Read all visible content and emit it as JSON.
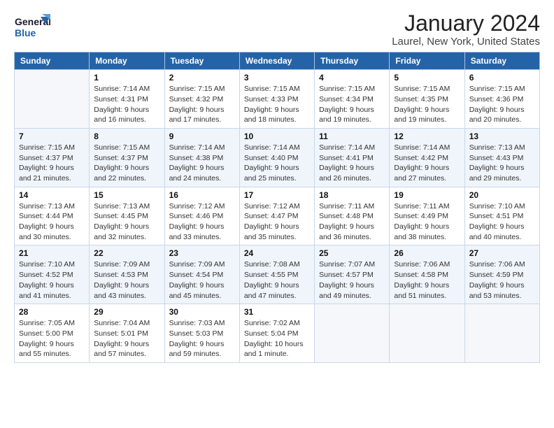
{
  "header": {
    "logo_general": "General",
    "logo_blue": "Blue",
    "title": "January 2024",
    "subtitle": "Laurel, New York, United States"
  },
  "calendar": {
    "days_of_week": [
      "Sunday",
      "Monday",
      "Tuesday",
      "Wednesday",
      "Thursday",
      "Friday",
      "Saturday"
    ],
    "weeks": [
      [
        {
          "day": "",
          "info": ""
        },
        {
          "day": "1",
          "info": "Sunrise: 7:14 AM\nSunset: 4:31 PM\nDaylight: 9 hours\nand 16 minutes."
        },
        {
          "day": "2",
          "info": "Sunrise: 7:15 AM\nSunset: 4:32 PM\nDaylight: 9 hours\nand 17 minutes."
        },
        {
          "day": "3",
          "info": "Sunrise: 7:15 AM\nSunset: 4:33 PM\nDaylight: 9 hours\nand 18 minutes."
        },
        {
          "day": "4",
          "info": "Sunrise: 7:15 AM\nSunset: 4:34 PM\nDaylight: 9 hours\nand 19 minutes."
        },
        {
          "day": "5",
          "info": "Sunrise: 7:15 AM\nSunset: 4:35 PM\nDaylight: 9 hours\nand 19 minutes."
        },
        {
          "day": "6",
          "info": "Sunrise: 7:15 AM\nSunset: 4:36 PM\nDaylight: 9 hours\nand 20 minutes."
        }
      ],
      [
        {
          "day": "7",
          "info": "Sunrise: 7:15 AM\nSunset: 4:37 PM\nDaylight: 9 hours\nand 21 minutes."
        },
        {
          "day": "8",
          "info": "Sunrise: 7:15 AM\nSunset: 4:37 PM\nDaylight: 9 hours\nand 22 minutes."
        },
        {
          "day": "9",
          "info": "Sunrise: 7:14 AM\nSunset: 4:38 PM\nDaylight: 9 hours\nand 24 minutes."
        },
        {
          "day": "10",
          "info": "Sunrise: 7:14 AM\nSunset: 4:40 PM\nDaylight: 9 hours\nand 25 minutes."
        },
        {
          "day": "11",
          "info": "Sunrise: 7:14 AM\nSunset: 4:41 PM\nDaylight: 9 hours\nand 26 minutes."
        },
        {
          "day": "12",
          "info": "Sunrise: 7:14 AM\nSunset: 4:42 PM\nDaylight: 9 hours\nand 27 minutes."
        },
        {
          "day": "13",
          "info": "Sunrise: 7:13 AM\nSunset: 4:43 PM\nDaylight: 9 hours\nand 29 minutes."
        }
      ],
      [
        {
          "day": "14",
          "info": "Sunrise: 7:13 AM\nSunset: 4:44 PM\nDaylight: 9 hours\nand 30 minutes."
        },
        {
          "day": "15",
          "info": "Sunrise: 7:13 AM\nSunset: 4:45 PM\nDaylight: 9 hours\nand 32 minutes."
        },
        {
          "day": "16",
          "info": "Sunrise: 7:12 AM\nSunset: 4:46 PM\nDaylight: 9 hours\nand 33 minutes."
        },
        {
          "day": "17",
          "info": "Sunrise: 7:12 AM\nSunset: 4:47 PM\nDaylight: 9 hours\nand 35 minutes."
        },
        {
          "day": "18",
          "info": "Sunrise: 7:11 AM\nSunset: 4:48 PM\nDaylight: 9 hours\nand 36 minutes."
        },
        {
          "day": "19",
          "info": "Sunrise: 7:11 AM\nSunset: 4:49 PM\nDaylight: 9 hours\nand 38 minutes."
        },
        {
          "day": "20",
          "info": "Sunrise: 7:10 AM\nSunset: 4:51 PM\nDaylight: 9 hours\nand 40 minutes."
        }
      ],
      [
        {
          "day": "21",
          "info": "Sunrise: 7:10 AM\nSunset: 4:52 PM\nDaylight: 9 hours\nand 41 minutes."
        },
        {
          "day": "22",
          "info": "Sunrise: 7:09 AM\nSunset: 4:53 PM\nDaylight: 9 hours\nand 43 minutes."
        },
        {
          "day": "23",
          "info": "Sunrise: 7:09 AM\nSunset: 4:54 PM\nDaylight: 9 hours\nand 45 minutes."
        },
        {
          "day": "24",
          "info": "Sunrise: 7:08 AM\nSunset: 4:55 PM\nDaylight: 9 hours\nand 47 minutes."
        },
        {
          "day": "25",
          "info": "Sunrise: 7:07 AM\nSunset: 4:57 PM\nDaylight: 9 hours\nand 49 minutes."
        },
        {
          "day": "26",
          "info": "Sunrise: 7:06 AM\nSunset: 4:58 PM\nDaylight: 9 hours\nand 51 minutes."
        },
        {
          "day": "27",
          "info": "Sunrise: 7:06 AM\nSunset: 4:59 PM\nDaylight: 9 hours\nand 53 minutes."
        }
      ],
      [
        {
          "day": "28",
          "info": "Sunrise: 7:05 AM\nSunset: 5:00 PM\nDaylight: 9 hours\nand 55 minutes."
        },
        {
          "day": "29",
          "info": "Sunrise: 7:04 AM\nSunset: 5:01 PM\nDaylight: 9 hours\nand 57 minutes."
        },
        {
          "day": "30",
          "info": "Sunrise: 7:03 AM\nSunset: 5:03 PM\nDaylight: 9 hours\nand 59 minutes."
        },
        {
          "day": "31",
          "info": "Sunrise: 7:02 AM\nSunset: 5:04 PM\nDaylight: 10 hours\nand 1 minute."
        },
        {
          "day": "",
          "info": ""
        },
        {
          "day": "",
          "info": ""
        },
        {
          "day": "",
          "info": ""
        }
      ]
    ]
  }
}
